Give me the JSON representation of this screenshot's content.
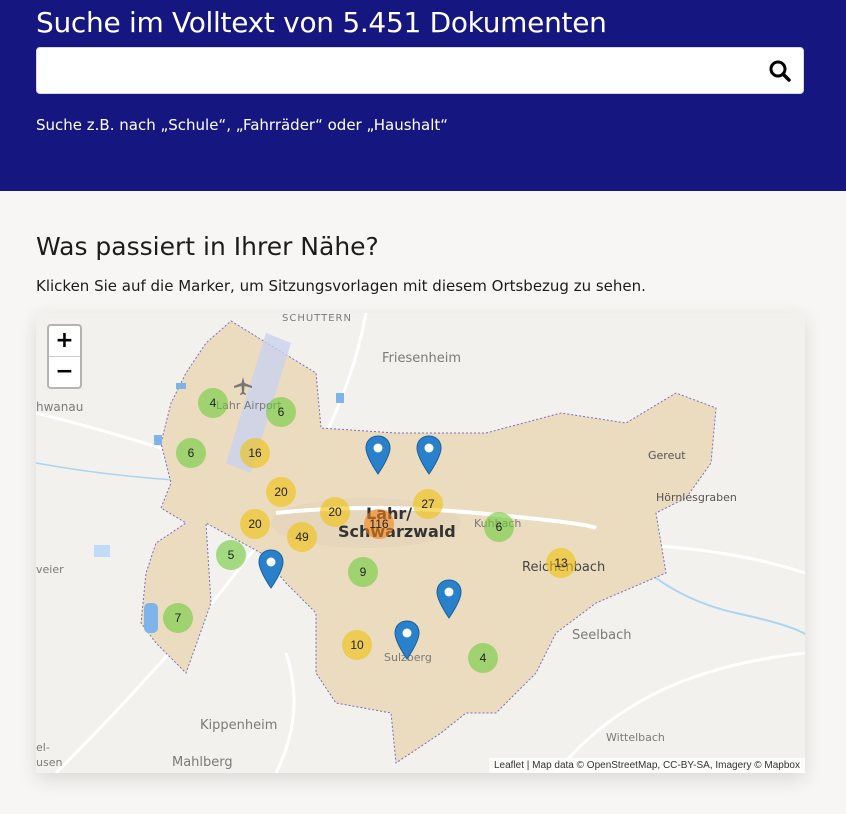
{
  "hero": {
    "title": "Suche im Volltext von 5.451 Dokumenten",
    "search_placeholder": "",
    "search_value": "",
    "search_icon": "search-icon",
    "hint": "Suche z.B. nach „Schule“, „Fahrräder“ oder „Haushalt“"
  },
  "section": {
    "title": "Was passiert in Ihrer Nähe?",
    "subtitle": "Klicken Sie auf die Marker, um Sitzungsvorlagen mit diesem Ortsbezug zu sehen."
  },
  "map": {
    "zoom_in": "+",
    "zoom_out": "−",
    "attribution": "Leaflet | Map data © OpenStreetMap, CC-BY-SA, Imagery © Mapbox",
    "places": {
      "schuttern": "SCHUTTERN",
      "friesenheim": "Friesenheim",
      "schwanau": "hwanau",
      "lahr_airport": "Lahr Airport",
      "gereut": "Gereut",
      "hoernlesgraben": "Hörnlesgraben",
      "lahr": "Lahr/",
      "schwarzwald": "Schwarzwald",
      "kuhbach": "Kuhbach",
      "reichenbach": "Reichenbach",
      "seelbach": "Seelbach",
      "sulzberg": "Sulzberg",
      "kippenheim": "Kippenheim",
      "wittelbach": "Wittelbach",
      "mahlberg": "Mahlberg",
      "weier": "veier",
      "left_l": "el-",
      "left_usen": "usen"
    },
    "clusters": [
      "4",
      "6",
      "6",
      "16",
      "20",
      "20",
      "20",
      "116",
      "27",
      "6",
      "49",
      "5",
      "9",
      "13",
      "7",
      "10",
      "4"
    ],
    "colors": {
      "brand": "#161680",
      "cluster_small": "#6ecc39",
      "cluster_medium": "#f0c20c",
      "cluster_large": "#f18017",
      "marker": "#2a81cb",
      "area": "#ebdcc0"
    }
  }
}
